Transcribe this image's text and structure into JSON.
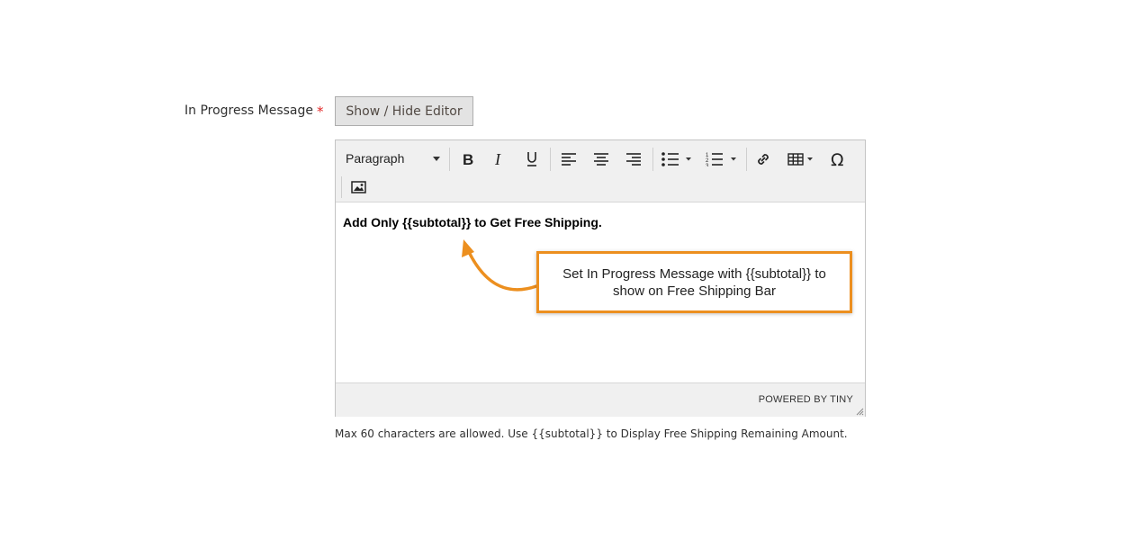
{
  "field": {
    "label": "In Progress Message",
    "required_mark": "*",
    "toggle_label": "Show / Hide Editor"
  },
  "editor": {
    "block_format": "Paragraph",
    "toolbar_icons": [
      "bold-icon",
      "italic-icon",
      "underline-icon",
      "align-left-icon",
      "align-center-icon",
      "align-right-icon",
      "bullet-list-icon",
      "numbered-list-icon",
      "link-icon",
      "table-icon",
      "special-character-icon",
      "image-icon"
    ],
    "content": "Add Only {{subtotal}} to Get Free Shipping.",
    "powered_by": "POWERED BY TINY"
  },
  "callout": {
    "text": "Set In Progress Message with {{subtotal}} to show on Free Shipping Bar",
    "border_color": "#ec8f1f"
  },
  "note": "Max 60 characters are allowed. Use {{subtotal}} to Display Free Shipping Remaining Amount."
}
